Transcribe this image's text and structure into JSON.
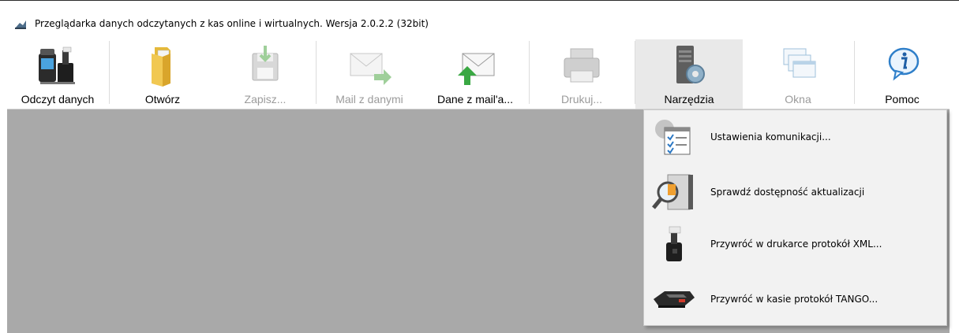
{
  "window": {
    "title": "Przeglądarka danych odczytanych z kas online i wirtualnych. Wersja 2.0.2.2 (32bit)"
  },
  "toolbar": {
    "buttons": [
      {
        "label": "Odczyt danych",
        "icon": "cash-register-printer-icon",
        "enabled": true
      },
      {
        "label": "Otwórz",
        "icon": "folder-icon",
        "enabled": true
      },
      {
        "label": "Zapisz...",
        "icon": "save-icon",
        "enabled": false
      },
      {
        "label": "Mail z danymi",
        "icon": "mail-send-icon",
        "enabled": false
      },
      {
        "label": "Dane z mail'a...",
        "icon": "mail-receive-icon",
        "enabled": true
      },
      {
        "label": "Drukuj...",
        "icon": "printer-icon",
        "enabled": false
      },
      {
        "label": "Narzędzia",
        "icon": "tools-server-icon",
        "enabled": true,
        "active": true
      },
      {
        "label": "Okna",
        "icon": "windows-icon",
        "enabled": false
      },
      {
        "label": "Pomoc",
        "icon": "info-icon",
        "enabled": true
      }
    ]
  },
  "tools_menu": {
    "items": [
      {
        "label": "Ustawienia komunikacji...",
        "icon": "settings-checklist-icon"
      },
      {
        "label": "Sprawdź dostępność aktualizacji",
        "icon": "magnifier-update-icon"
      },
      {
        "label": "Przywróć w drukarce protokół XML...",
        "icon": "fiscal-printer-icon"
      },
      {
        "label": "Przywróć w kasie protokół TANGO...",
        "icon": "cash-register-icon"
      }
    ]
  },
  "colors": {
    "workarea": "#a9a9a9",
    "menu_background": "#f2f2f2",
    "disabled_text": "#9b9b9b",
    "active_button": "#e9e9e9"
  }
}
